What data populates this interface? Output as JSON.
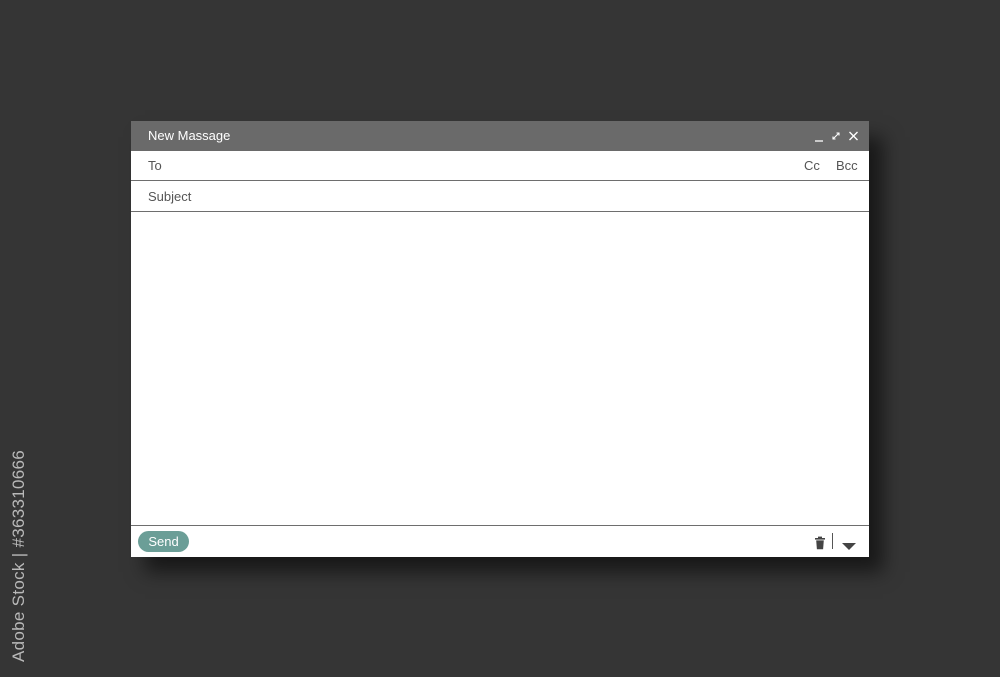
{
  "stock_id": "Adobe Stock | #363310666",
  "window": {
    "title": "New Massage",
    "controls": {
      "minimize_icon": "minimize-icon",
      "expand_icon": "expand-icon",
      "close_icon": "close-icon"
    }
  },
  "fields": {
    "to_label": "To",
    "to_value": "",
    "cc_label": "Cc",
    "bcc_label": "Bcc",
    "subject_label": "Subject",
    "subject_value": "",
    "body_value": ""
  },
  "footer": {
    "send_label": "Send",
    "trash_icon": "trash-icon",
    "more_icon": "chevron-down-icon"
  },
  "colors": {
    "background": "#353535",
    "titlebar": "#6a6a6a",
    "send_button": "#6b9e97"
  }
}
